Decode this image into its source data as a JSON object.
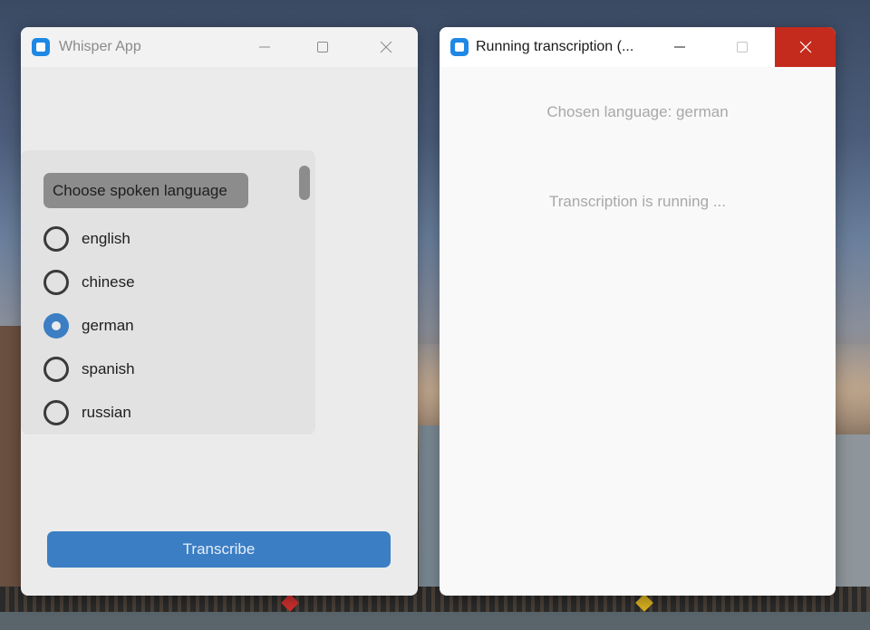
{
  "main_window": {
    "title": "Whisper App",
    "language_prompt": "Choose spoken language",
    "languages": [
      {
        "label": "english",
        "selected": false
      },
      {
        "label": "chinese",
        "selected": false
      },
      {
        "label": "german",
        "selected": true
      },
      {
        "label": "spanish",
        "selected": false
      },
      {
        "label": "russian",
        "selected": false
      }
    ],
    "transcribe_label": "Transcribe"
  },
  "run_window": {
    "title": "Running transcription (...",
    "chosen_language_text": "Chosen language: german",
    "status_text": "Transcription is running ..."
  },
  "icons": {
    "app": "app-square-icon",
    "minimize": "minimize-icon",
    "maximize": "maximize-icon",
    "close": "close-icon"
  },
  "colors": {
    "accent": "#3b7ec4",
    "close_hover": "#c42b1c",
    "app_icon": "#1e88e5"
  }
}
